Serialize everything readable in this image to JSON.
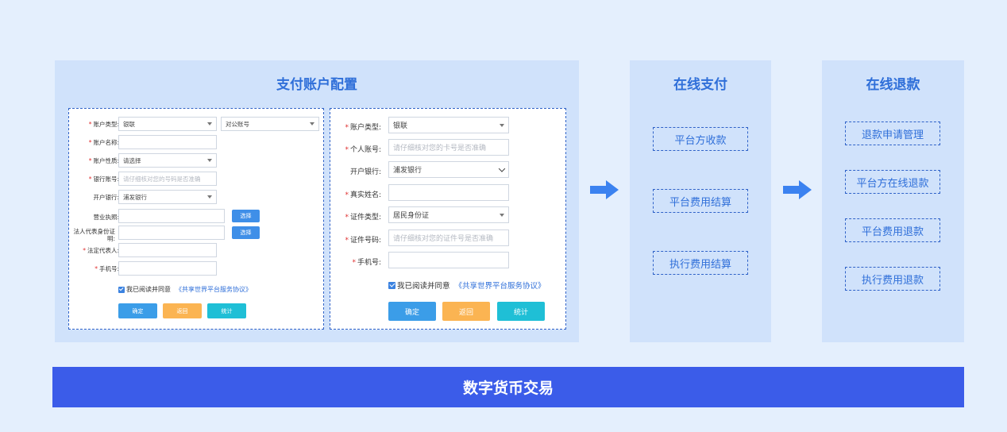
{
  "config_panel": {
    "title": "支付账户配置",
    "form_small": {
      "fields": {
        "account_type": {
          "label": "账户类型:",
          "value": "银联",
          "value2": "对公账号"
        },
        "account_name": {
          "label": "账户名称:",
          "value": ""
        },
        "account_nature": {
          "label": "账户性质:",
          "value": "请选择"
        },
        "bank_account": {
          "label": "银行账号:",
          "placeholder": "请仔细核对您的号码是否准确"
        },
        "open_bank": {
          "label": "开户银行:",
          "value": "浦发银行"
        },
        "business_license": {
          "label": "营业执照:",
          "button": "选择"
        },
        "legal_id_proof": {
          "label": "法人代表身份证明:",
          "button": "选择"
        },
        "legal_rep": {
          "label": "法定代表人:",
          "value": ""
        },
        "phone": {
          "label": "手机号:",
          "value": ""
        }
      },
      "agree_text": "我已阅读并同意",
      "agree_link": "《共享世界平台服务协议》",
      "buttons": {
        "confirm": "确定",
        "back": "返回",
        "stats": "统计"
      }
    },
    "form_large": {
      "fields": {
        "account_type": {
          "label": "账户类型:",
          "value": "银联"
        },
        "personal_account": {
          "label": "个人账号:",
          "placeholder": "请仔细核对您的卡号是否准确"
        },
        "open_bank": {
          "label": "开户银行:",
          "value": "浦发银行"
        },
        "real_name": {
          "label": "真实姓名:",
          "value": ""
        },
        "id_type": {
          "label": "证件类型:",
          "value": "居民身份证"
        },
        "id_number": {
          "label": "证件号码:",
          "placeholder": "请仔细核对您的证件号是否准确"
        },
        "phone": {
          "label": "手机号:",
          "value": ""
        }
      },
      "agree_text": "我已阅读并同意",
      "agree_link": "《共享世界平台服务协议》",
      "buttons": {
        "confirm": "确定",
        "back": "返回",
        "stats": "统计"
      }
    }
  },
  "online_pay": {
    "title": "在线支付",
    "items": [
      "平台方收款",
      "平台费用结算",
      "执行费用结算"
    ]
  },
  "online_refund": {
    "title": "在线退款",
    "items": [
      "退款申请管理",
      "平台方在线退款",
      "平台费用退款",
      "执行费用退款"
    ]
  },
  "bottom_bar": {
    "label": "数字货币交易"
  },
  "colors": {
    "page_bg": "#e4effd",
    "panel_bg": "#d0e2fb",
    "title_blue": "#2f6fd9",
    "bar_blue": "#3b5ce9",
    "arrow_blue": "#3b82f0"
  }
}
